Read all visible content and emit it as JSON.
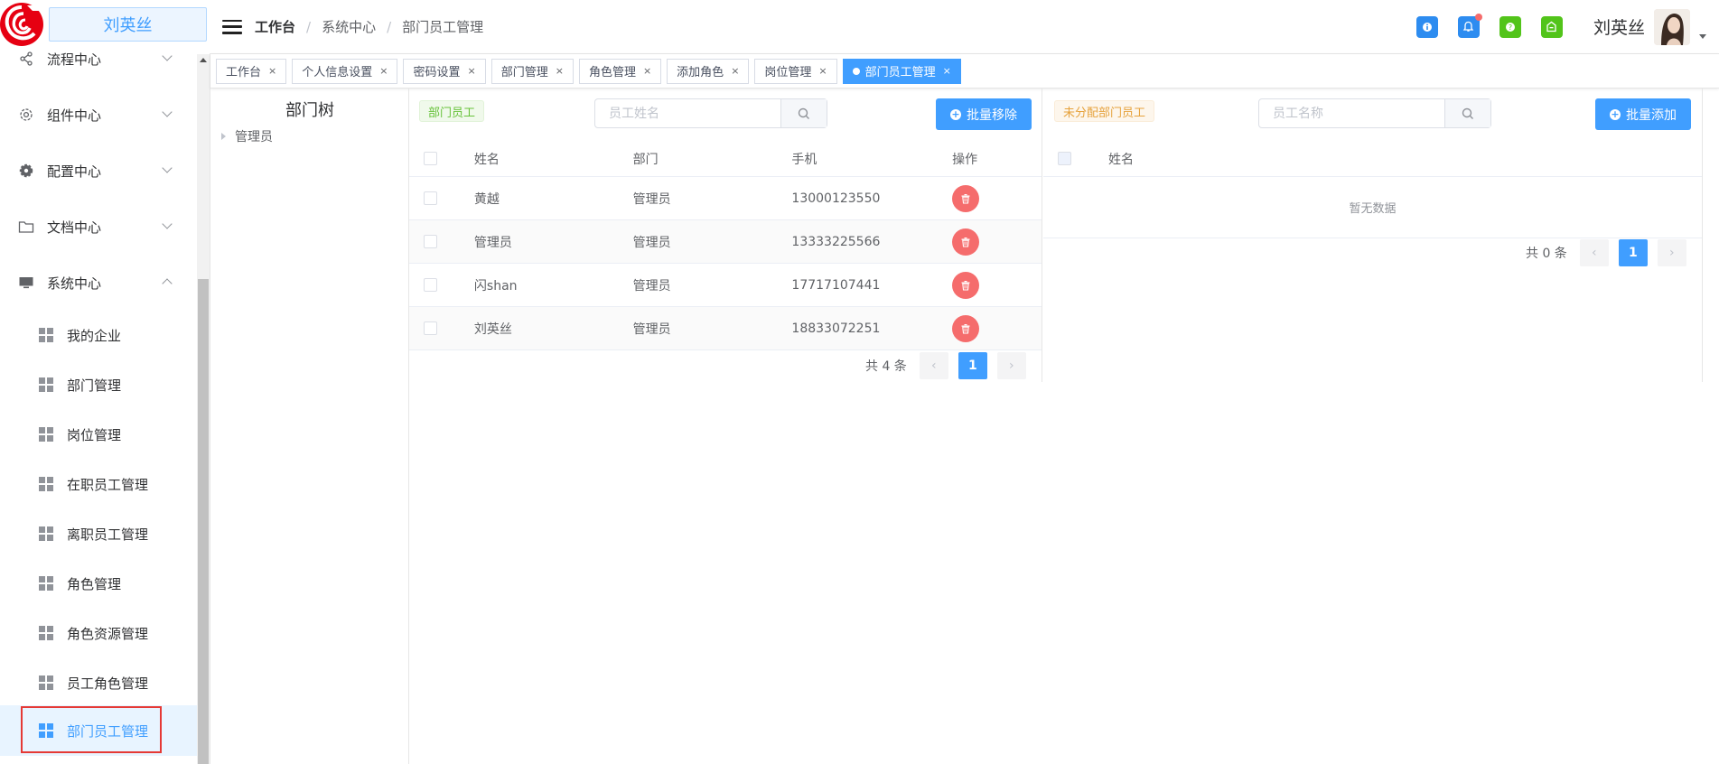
{
  "app": {
    "user_title": "刘英丝",
    "logo_icon": "red-swirl-logo"
  },
  "header": {
    "breadcrumb": [
      "工作台",
      "系统中心",
      "部门员工管理"
    ],
    "username": "刘英丝",
    "icons": [
      "info-icon",
      "bell-icon",
      "help-icon",
      "store-icon"
    ]
  },
  "sidebar": {
    "menus": [
      {
        "label": "流程中心",
        "icon": "share-icon",
        "expanded": false
      },
      {
        "label": "组件中心",
        "icon": "gear-outline-icon",
        "expanded": false
      },
      {
        "label": "配置中心",
        "icon": "gear-solid-icon",
        "expanded": false
      },
      {
        "label": "文档中心",
        "icon": "folder-icon",
        "expanded": false
      },
      {
        "label": "系统中心",
        "icon": "monitor-icon",
        "expanded": true
      }
    ],
    "sub_items": [
      "我的企业",
      "部门管理",
      "岗位管理",
      "在职员工管理",
      "离职员工管理",
      "角色管理",
      "角色资源管理",
      "员工角色管理",
      "部门员工管理"
    ],
    "active_sub": "部门员工管理"
  },
  "tags": [
    "工作台",
    "个人信息设置",
    "密码设置",
    "部门管理",
    "角色管理",
    "添加角色",
    "岗位管理",
    "部门员工管理"
  ],
  "active_tag": "部门员工管理",
  "tree": {
    "title": "部门树",
    "nodes": [
      "管理员"
    ]
  },
  "dept_staff": {
    "badge": "部门员工",
    "search_placeholder": "员工姓名",
    "action": "批量移除",
    "columns": [
      "姓名",
      "部门",
      "手机",
      "操作"
    ],
    "rows": [
      {
        "name": "黄越",
        "dept": "管理员",
        "phone": "13000123550"
      },
      {
        "name": "管理员",
        "dept": "管理员",
        "phone": "13333225566"
      },
      {
        "name": "闪shan",
        "dept": "管理员",
        "phone": "17717107441"
      },
      {
        "name": "刘英丝",
        "dept": "管理员",
        "phone": "18833072251"
      }
    ],
    "total": "共 4 条",
    "page": "1"
  },
  "unassigned": {
    "badge": "未分配部门员工",
    "search_placeholder": "员工名称",
    "action": "批量添加",
    "columns": [
      "姓名"
    ],
    "empty_text": "暂无数据",
    "total": "共 0 条",
    "page": "1"
  },
  "colors": {
    "primary": "#409eff",
    "danger": "#f56c6c",
    "success": "#67c23a",
    "warning": "#e6a23c",
    "highlight": "#e53935"
  }
}
